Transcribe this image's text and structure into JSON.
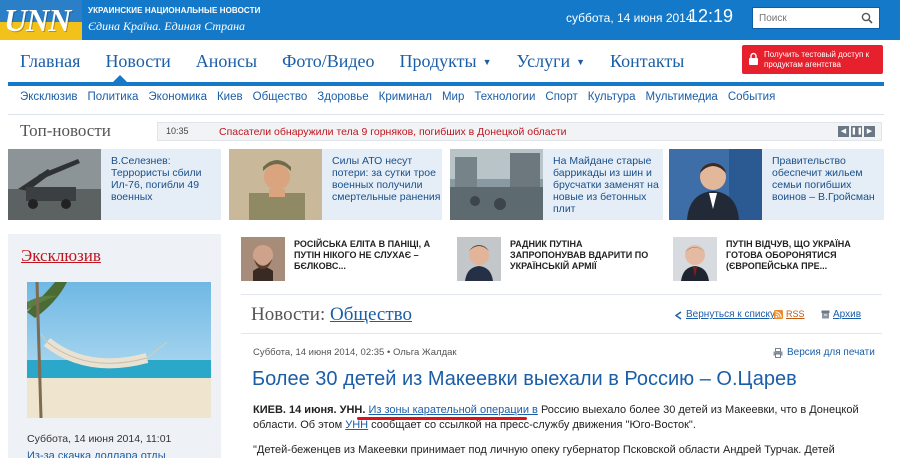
{
  "header": {
    "logo": "UNN",
    "tagline_top": "УКРАИНСКИЕ НАЦИОНАЛЬНЫЕ НОВОСТИ",
    "tagline_bottom": "Єдина Країна. Единая Страна",
    "date": "суббота, 14 июня 2014",
    "time": "12:19",
    "search_placeholder": "Поиск"
  },
  "main_nav": {
    "items": [
      "Главная",
      "Новости",
      "Анонсы",
      "Фото/Видео",
      "Продукты",
      "Услуги",
      "Контакты"
    ],
    "active": "Новости"
  },
  "promo": {
    "label": "Получить тестовый доступ к продуктам агентства"
  },
  "sub_nav": {
    "items": [
      "Эксклюзив",
      "Политика",
      "Экономика",
      "Киев",
      "Общество",
      "Здоровье",
      "Криминал",
      "Мир",
      "Технологии",
      "Спорт",
      "Культура",
      "Мультимедиа",
      "События"
    ]
  },
  "top_news": {
    "title": "Топ-новости",
    "ticker_time": "10:35",
    "ticker_text": "Спасатели обнаружили тела 9 горняков, погибших в Донецкой области",
    "cards": [
      "В.Селезнев: Террористы сбили Ил-76, погибли 49 военных",
      "Силы АТО несут потери: за сутки трое военных получили смертельные ранения",
      "На Майдане старые баррикады из шин и брусчатки заменят на новые из бетонных плит",
      "Правительство обеспечит жильем семьи погибших воинов – В.Гройсман"
    ]
  },
  "sidebar": {
    "title": "Эксклюзив",
    "date": "Суббота, 14 июня 2014, 11:01",
    "teaser": "Из-за скачка доллара отды"
  },
  "mini_news": [
    "Російська еліта в паніці, а Путін нікого не слухає – Бєлковс...",
    "Радник Путіна запропонував вдарити по українській армії",
    "Путін відчув, що Україна готова оборонятися (європейська пре..."
  ],
  "article": {
    "section_prefix": "Новости:",
    "section_name": "Общество",
    "back_label": "Вернуться к списку",
    "rss_label": "RSS",
    "archive_label": "Архив",
    "meta": "Суббота, 14 июня 2014, 02:35 • Ольга Жалдак",
    "print_label": "Версия для печати",
    "headline": "Более 30 детей из Макеевки выехали в Россию – О.Царев",
    "lead_dateline": "КИЕВ. 14 июня. УНН.",
    "lead_part1": "Из зоны карательной операции в",
    "lead_part2": "Россию выехало более 30 детей из Макеевки, что в Донецкой области. Об этом",
    "lead_link": "УНН",
    "lead_part3": "сообщает со ссылкой на пресс-службу движения \"Юго-Восток\".",
    "para2": "\"Детей-беженцев из Макеевки принимает под личную опеку губернатор Псковской области Андрей Турчак. Детей"
  },
  "colors": {
    "brand_blue": "#1479c8",
    "accent_red": "#e6202d",
    "link_blue": "#1a5ea8"
  }
}
